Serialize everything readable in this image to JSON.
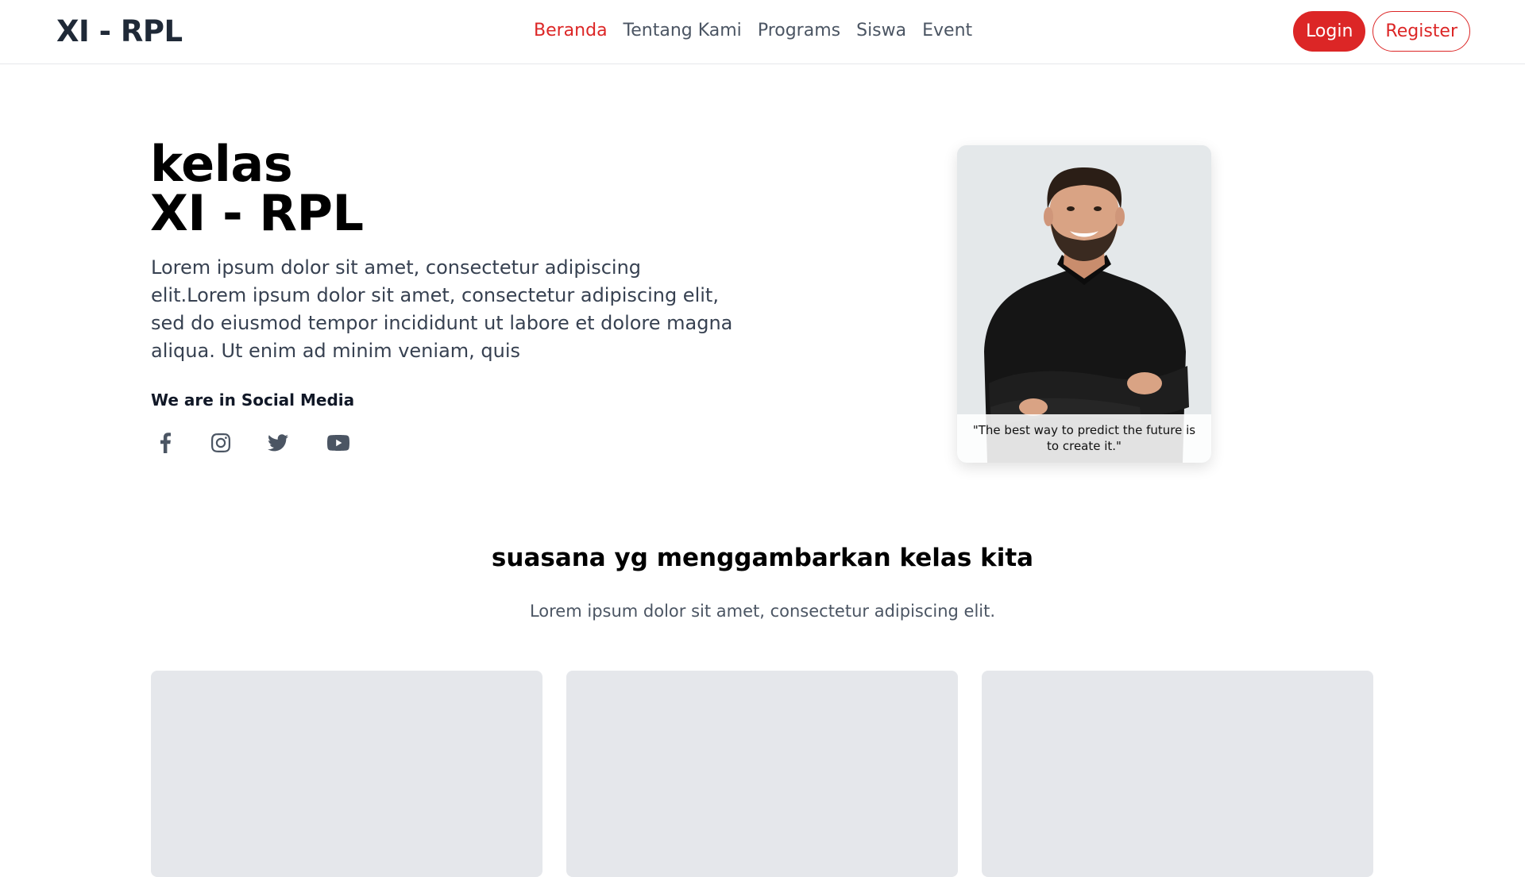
{
  "header": {
    "brand": "XI - RPL",
    "nav": [
      {
        "label": "Beranda",
        "active": true
      },
      {
        "label": "Tentang Kami",
        "active": false
      },
      {
        "label": "Programs",
        "active": false
      },
      {
        "label": "Siswa",
        "active": false
      },
      {
        "label": "Event",
        "active": false
      }
    ],
    "login_label": "Login",
    "register_label": "Register"
  },
  "hero": {
    "title_line1": "kelas",
    "title_line2": "XI - RPL",
    "description": "Lorem ipsum dolor sit amet, consectetur adipiscing elit.Lorem ipsum dolor sit amet, consectetur adipiscing elit, sed do eiusmod tempor incididunt ut labore et dolore magna aliqua. Ut enim ad minim veniam, quis",
    "social_label": "We are in Social Media",
    "social_icons": [
      "facebook-icon",
      "instagram-icon",
      "twitter-icon",
      "youtube-icon"
    ]
  },
  "profile": {
    "quote": "\"The best way to predict the future is to create it.\""
  },
  "section": {
    "title": "suasana yg menggambarkan kelas kita",
    "subtitle": "Lorem ipsum dolor sit amet, consectetur adipiscing elit."
  },
  "colors": {
    "accent": "#dc2626",
    "text_dark": "#111827",
    "text_muted": "#4b5563",
    "placeholder": "#e5e7eb"
  }
}
